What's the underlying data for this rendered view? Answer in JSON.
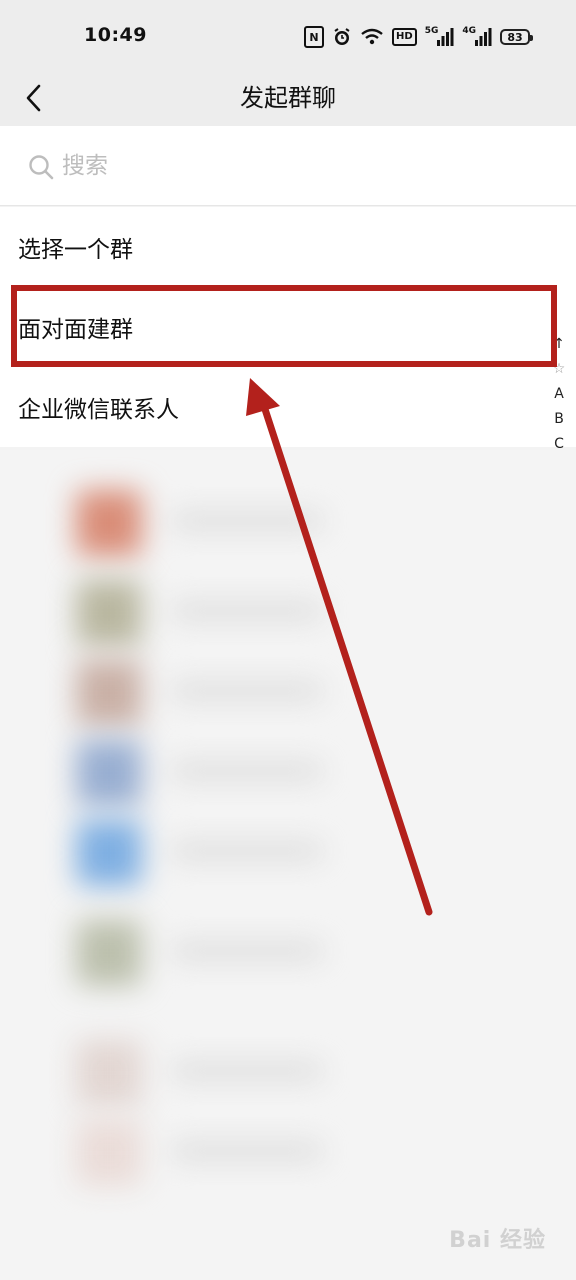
{
  "status_bar": {
    "time": "10:49",
    "nfc": "N",
    "hd": "HD",
    "net1": "5G",
    "net2": "4G",
    "battery": "83"
  },
  "nav": {
    "title": "发起群聊"
  },
  "search": {
    "placeholder": "搜索"
  },
  "menu": {
    "items": [
      {
        "label": "选择一个群"
      },
      {
        "label": "面对面建群"
      },
      {
        "label": "企业微信联系人"
      }
    ]
  },
  "index_bar": [
    "↑",
    "☆",
    "A",
    "B",
    "C"
  ],
  "watermark": "Bai 经验",
  "colors": {
    "highlight": "#b3211c",
    "arrow": "#b3211c",
    "nav_bg": "#ededed"
  }
}
